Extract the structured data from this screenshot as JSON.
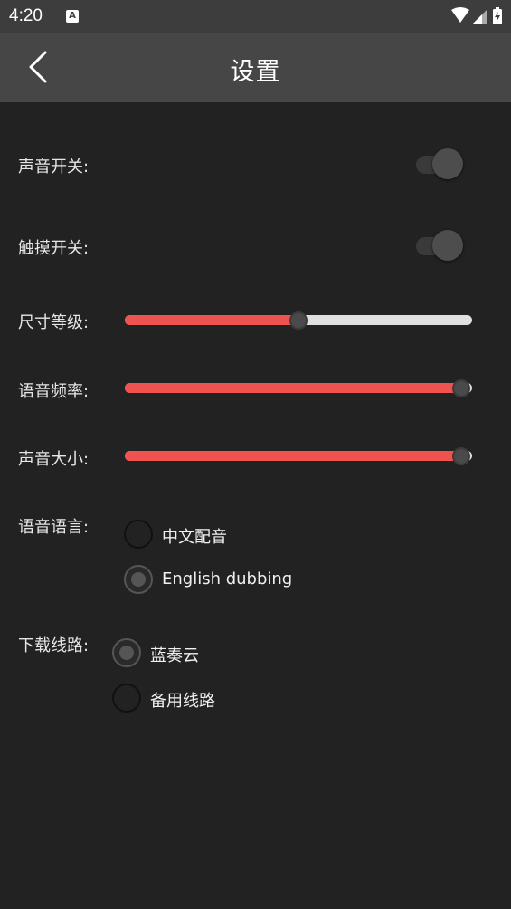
{
  "status_bar": {
    "time": "4:20",
    "notification_badge": "A"
  },
  "toolbar": {
    "title": "设置"
  },
  "settings": {
    "sound_switch": {
      "label": "声音开关:",
      "on": false
    },
    "touch_switch": {
      "label": "触摸开关:",
      "on": false
    },
    "size_level": {
      "label": "尺寸等级:",
      "value": 0.5
    },
    "voice_rate": {
      "label": "语音频率:",
      "value": 0.97
    },
    "volume": {
      "label": "声音大小:",
      "value": 0.97
    },
    "voice_language": {
      "label": "语音语言:",
      "options": [
        {
          "label": "中文配音",
          "selected": false
        },
        {
          "label": "English dubbing",
          "selected": true
        }
      ]
    },
    "download_route": {
      "label": "下载线路:",
      "options": [
        {
          "label": "蓝奏云",
          "selected": true
        },
        {
          "label": "备用线路",
          "selected": false
        }
      ]
    }
  },
  "colors": {
    "accent": "#ef5350",
    "background": "#222222",
    "toolbar": "#464646",
    "status_bar": "#3d3d3d"
  }
}
